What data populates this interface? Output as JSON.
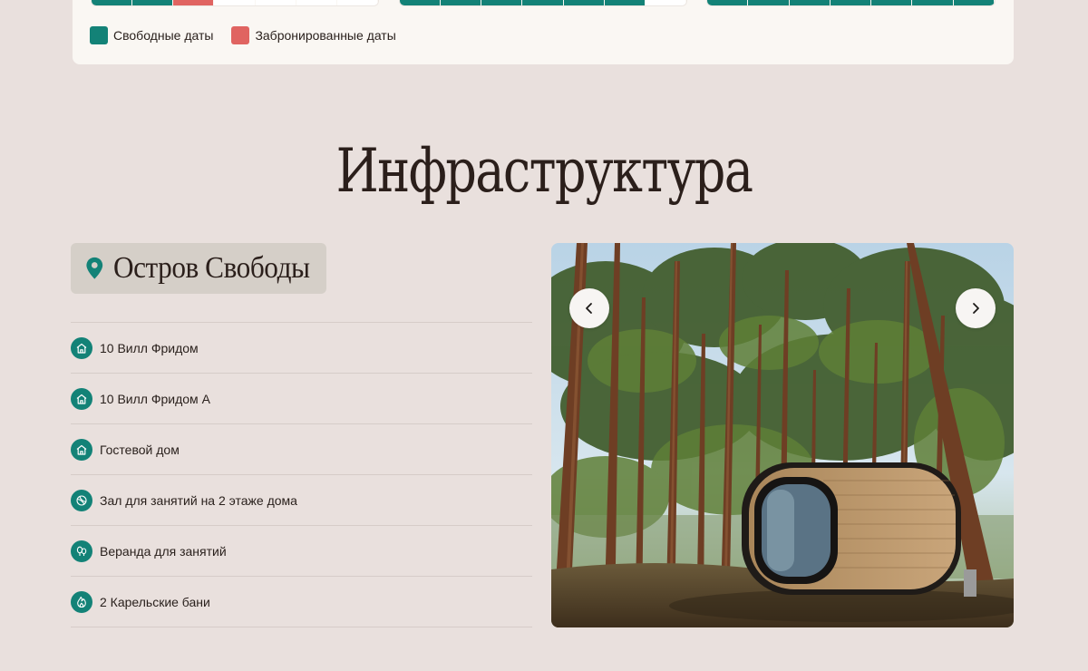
{
  "calendar": {
    "strips": [
      {
        "cells": [
          "free",
          "free",
          "booked",
          "empty",
          "empty",
          "empty",
          "empty"
        ]
      },
      {
        "cells": [
          "free",
          "free",
          "free",
          "free",
          "free",
          "free",
          "empty"
        ]
      },
      {
        "cells": [
          "free",
          "free",
          "free",
          "free",
          "free",
          "free",
          "free"
        ]
      }
    ],
    "legend": {
      "free_label": "Свободные даты",
      "booked_label": "Забронированные даты"
    },
    "colors": {
      "free": "#138277",
      "booked": "#e06461"
    }
  },
  "section": {
    "title": "Инфраструктура",
    "location": "Остров Свободы",
    "facilities": [
      {
        "label": "10 Вилл Фридом",
        "icon": "house-icon"
      },
      {
        "label": "10 Вилл Фридом А",
        "icon": "house-icon"
      },
      {
        "label": "Гостевой дом",
        "icon": "house-icon"
      },
      {
        "label": "Зал для занятий на 2 этаже дома",
        "icon": "ball-icon"
      },
      {
        "label": "Веранда для занятий",
        "icon": "trees-icon"
      },
      {
        "label": "2 Карельские бани",
        "icon": "flame-icon"
      }
    ]
  },
  "carousel": {
    "image": "pine-forest-cabin-photo",
    "prev_icon": "chevron-left-icon",
    "next_icon": "chevron-right-icon"
  }
}
